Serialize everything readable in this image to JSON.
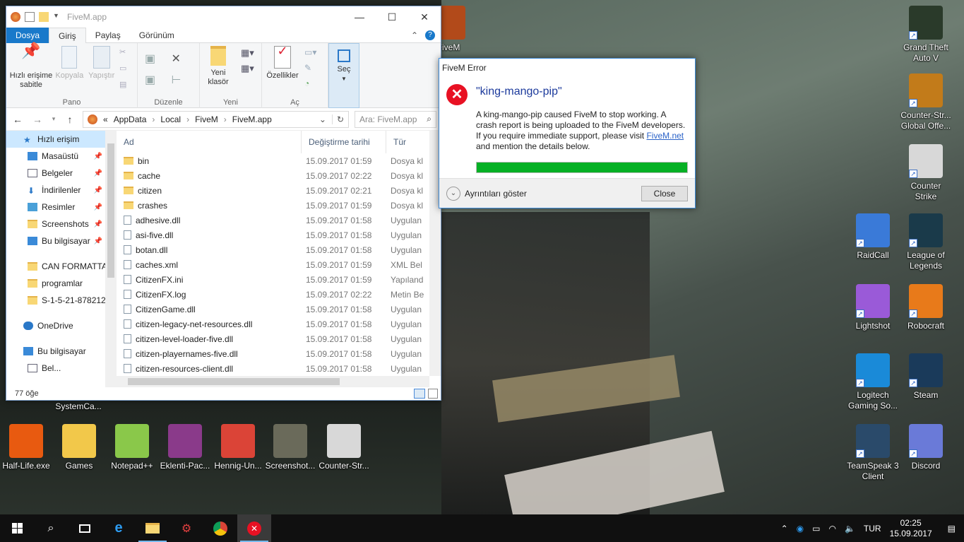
{
  "explorer": {
    "title": "FiveM.app",
    "tabs": [
      "Dosya",
      "Giriş",
      "Paylaş",
      "Görünüm"
    ],
    "ribbon": {
      "pin_label": "Hızlı erişime sabitle",
      "copy_label": "Kopyala",
      "paste_label": "Yapıştır",
      "group_pano": "Pano",
      "group_duzenle": "Düzenle",
      "new_folder_label": "Yeni klasör",
      "group_yeni": "Yeni",
      "properties_label": "Özellikler",
      "group_ac": "Aç",
      "select_label": "Seç"
    },
    "address": {
      "crumbs": [
        "«",
        "AppData",
        "Local",
        "FiveM",
        "FiveM.app"
      ],
      "search_placeholder": "Ara: FiveM.app"
    },
    "nav": [
      {
        "label": "Hızlı erişim",
        "type": "star"
      },
      {
        "label": "Masaüstü",
        "type": "desktop",
        "pinned": true
      },
      {
        "label": "Belgeler",
        "type": "doc",
        "pinned": true
      },
      {
        "label": "İndirilenler",
        "type": "down",
        "pinned": true
      },
      {
        "label": "Resimler",
        "type": "pic",
        "pinned": true
      },
      {
        "label": "Screenshots",
        "type": "folder",
        "pinned": true
      },
      {
        "label": "Bu bilgisayar",
        "type": "pc",
        "pinned": true
      },
      {
        "label": "",
        "type": "gap"
      },
      {
        "label": "CAN FORMATTA",
        "type": "folder"
      },
      {
        "label": "programlar",
        "type": "folder"
      },
      {
        "label": "S-1-5-21-878212",
        "type": "folder"
      },
      {
        "label": "",
        "type": "gap"
      },
      {
        "label": "OneDrive",
        "type": "cloud"
      },
      {
        "label": "",
        "type": "gap"
      },
      {
        "label": "Bu bilgisayar",
        "type": "pc"
      },
      {
        "label": "Bel...",
        "type": "doc"
      }
    ],
    "columns": [
      "Ad",
      "Değiştirme tarihi",
      "Tür"
    ],
    "files": [
      {
        "name": "bin",
        "date": "15.09.2017 01:59",
        "type": "Dosya kl",
        "kind": "folder"
      },
      {
        "name": "cache",
        "date": "15.09.2017 02:22",
        "type": "Dosya kl",
        "kind": "folder"
      },
      {
        "name": "citizen",
        "date": "15.09.2017 02:21",
        "type": "Dosya kl",
        "kind": "folder"
      },
      {
        "name": "crashes",
        "date": "15.09.2017 01:59",
        "type": "Dosya kl",
        "kind": "folder"
      },
      {
        "name": "adhesive.dll",
        "date": "15.09.2017 01:58",
        "type": "Uygulan",
        "kind": "file"
      },
      {
        "name": "asi-five.dll",
        "date": "15.09.2017 01:58",
        "type": "Uygulan",
        "kind": "file"
      },
      {
        "name": "botan.dll",
        "date": "15.09.2017 01:58",
        "type": "Uygulan",
        "kind": "file"
      },
      {
        "name": "caches.xml",
        "date": "15.09.2017 01:59",
        "type": "XML Bel",
        "kind": "file"
      },
      {
        "name": "CitizenFX.ini",
        "date": "15.09.2017 01:59",
        "type": "Yapıland",
        "kind": "file"
      },
      {
        "name": "CitizenFX.log",
        "date": "15.09.2017 02:22",
        "type": "Metin Be",
        "kind": "file"
      },
      {
        "name": "CitizenGame.dll",
        "date": "15.09.2017 01:58",
        "type": "Uygulan",
        "kind": "file"
      },
      {
        "name": "citizen-legacy-net-resources.dll",
        "date": "15.09.2017 01:58",
        "type": "Uygulan",
        "kind": "file"
      },
      {
        "name": "citizen-level-loader-five.dll",
        "date": "15.09.2017 01:58",
        "type": "Uygulan",
        "kind": "file"
      },
      {
        "name": "citizen-playernames-five.dll",
        "date": "15.09.2017 01:58",
        "type": "Uygulan",
        "kind": "file"
      },
      {
        "name": "citizen-resources-client.dll",
        "date": "15.09.2017 01:58",
        "type": "Uygulan",
        "kind": "file"
      }
    ],
    "status": "77 öğe"
  },
  "dialog": {
    "title": "FiveM Error",
    "heading": "\"king-mango-pip\"",
    "message_pre": "A king-mango-pip caused FiveM to stop working. A crash report is being uploaded to the FiveM developers. If you require immediate support, please visit ",
    "link": "FiveM.net",
    "message_post": " and mention the details below.",
    "progress": 1.0,
    "details_label": "Ayrıntıları göster",
    "close_label": "Close"
  },
  "desktop": {
    "right_icons": [
      {
        "label": "FiveM",
        "color": "#b24a1a"
      },
      {
        "label": "Grand Theft Auto V",
        "color": "#2a3a2a"
      },
      {
        "label": "Counter-Str... Global Offe...",
        "color": "#c27b1a"
      },
      {
        "label": "Counter Strike",
        "color": "#d8d8d8"
      },
      {
        "label": "RaidCall",
        "color": "#3a7ad8"
      },
      {
        "label": "League of Legends",
        "color": "#1a3a4a"
      },
      {
        "label": "Lightshot",
        "color": "#9a5ad8"
      },
      {
        "label": "Robocraft",
        "color": "#e87a1a"
      },
      {
        "label": "Logitech Gaming So...",
        "color": "#1a8ad8"
      },
      {
        "label": "Steam",
        "color": "#1a3a5a"
      },
      {
        "label": "TeamSpeak 3 Client",
        "color": "#2a4a6a"
      },
      {
        "label": "Discord",
        "color": "#6a7ad8"
      }
    ],
    "bottom_icons": [
      {
        "label": "Half-Life.exe",
        "color": "#e85a10"
      },
      {
        "label": "Games",
        "color": "#f2c84a"
      },
      {
        "label": "Notepad++",
        "color": "#8ac84a"
      },
      {
        "label": "Eklenti-Pac...",
        "color": "#8a3a8a"
      },
      {
        "label": "Hennig-Un...",
        "color": "#db4437"
      },
      {
        "label": "Screenshot...",
        "color": "#6a6a5a"
      },
      {
        "label": "Counter-Str...",
        "color": "#d8d8d8"
      }
    ],
    "partial_label": "SystemCa..."
  },
  "taskbar": {
    "language": "TUR",
    "time": "02:25",
    "date": "15.09.2017"
  }
}
